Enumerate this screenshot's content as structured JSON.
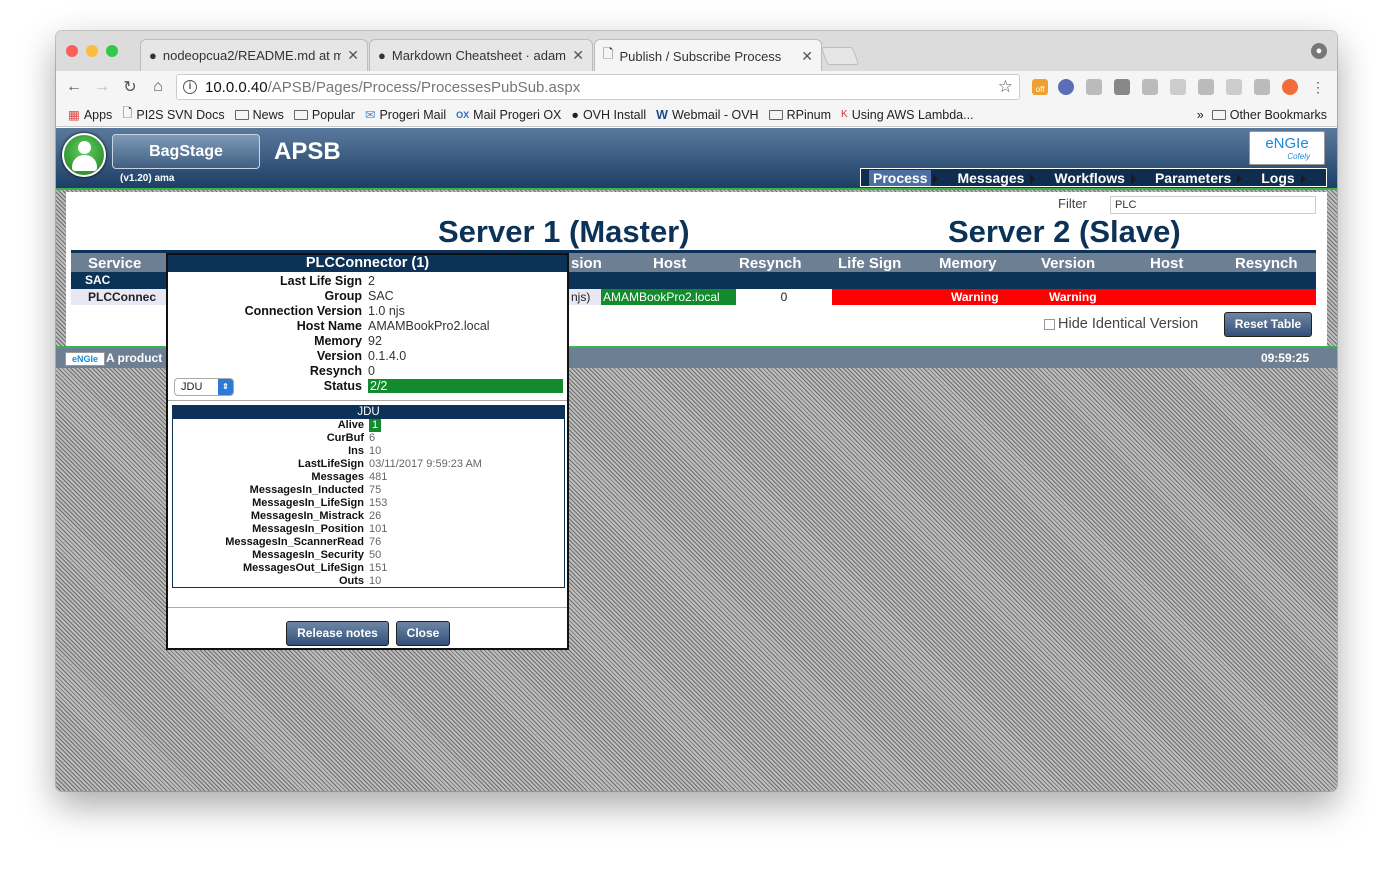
{
  "browser": {
    "tabs": [
      {
        "title": "nodeopcua2/README.md at m"
      },
      {
        "title": "Markdown Cheatsheet · adam"
      },
      {
        "title": "Publish / Subscribe Process"
      }
    ],
    "url_host": "10.0.0.40",
    "url_path": "/APSB/Pages/Process/ProcessesPubSub.aspx",
    "bookmarks": [
      "Apps",
      "PI2S SVN Docs",
      "News",
      "Popular",
      "Progeri Mail",
      "Mail Progeri OX",
      "OVH Install",
      "Webmail - OVH",
      "RPinum",
      "Using AWS Lambda..."
    ],
    "bookmarks_more": "»",
    "other_bookmarks": "Other Bookmarks",
    "ext_badge": "off"
  },
  "app": {
    "stage_button": "BagStage",
    "version": "(v1.20) ama",
    "title": "APSB",
    "logo_text": "eNGIe",
    "logo_sub": "Cofely",
    "menu": [
      "Process",
      "Messages",
      "Workflows",
      "Parameters",
      "Logs"
    ]
  },
  "main": {
    "filter_label": "Filter",
    "filter_value": "PLC",
    "server1": "Server 1 (Master)",
    "server2": "Server 2 (Slave)",
    "columns": {
      "service": "Service",
      "version1": "sion",
      "host1": "Host",
      "resynch1": "Resynch",
      "lifesign2": "Life Sign",
      "memory2": "Memory",
      "version2": "Version",
      "host2": "Host",
      "resynch2": "Resynch"
    },
    "group": "SAC",
    "row": {
      "service": "PLCConnec",
      "version1": "njs)",
      "host1": "AMAMBookPro2.local",
      "resynch1": "0",
      "memory2": "Warning",
      "version2": "Warning"
    },
    "hide_identical": "Hide Identical Version",
    "reset_button": "Reset Table"
  },
  "footer": {
    "logo": "eNGIe",
    "product": "A product",
    "clock": "09:59:25"
  },
  "modal": {
    "title": "PLCConnector (1)",
    "fields": [
      {
        "k": "Last Life Sign",
        "v": "2"
      },
      {
        "k": "Group",
        "v": "SAC"
      },
      {
        "k": "Connection Version",
        "v": "1.0 njs"
      },
      {
        "k": "Host Name",
        "v": "AMAMBookPro2.local"
      },
      {
        "k": "Memory",
        "v": "92"
      },
      {
        "k": "Version",
        "v": "0.1.4.0"
      },
      {
        "k": "Resynch",
        "v": "0"
      },
      {
        "k": "Status",
        "v": "2/2"
      }
    ],
    "select_value": "JDU",
    "sub_title": "JDU",
    "sub_fields": [
      {
        "k": "Alive",
        "v": "1"
      },
      {
        "k": "CurBuf",
        "v": "6"
      },
      {
        "k": "Ins",
        "v": "10"
      },
      {
        "k": "LastLifeSign",
        "v": "03/11/2017 9:59:23 AM"
      },
      {
        "k": "Messages",
        "v": "481"
      },
      {
        "k": "MessagesIn_Inducted",
        "v": "75"
      },
      {
        "k": "MessagesIn_LifeSign",
        "v": "153"
      },
      {
        "k": "MessagesIn_Mistrack",
        "v": "26"
      },
      {
        "k": "MessagesIn_Position",
        "v": "101"
      },
      {
        "k": "MessagesIn_ScannerRead",
        "v": "76"
      },
      {
        "k": "MessagesIn_Security",
        "v": "50"
      },
      {
        "k": "MessagesOut_LifeSign",
        "v": "151"
      },
      {
        "k": "Outs",
        "v": "10"
      }
    ],
    "release_notes": "Release notes",
    "close": "Close"
  },
  "colors": {
    "navy": "#0d3257",
    "ok_green": "#138a2e",
    "warning_red": "#ff0000",
    "accent_green": "#3bb34a"
  }
}
